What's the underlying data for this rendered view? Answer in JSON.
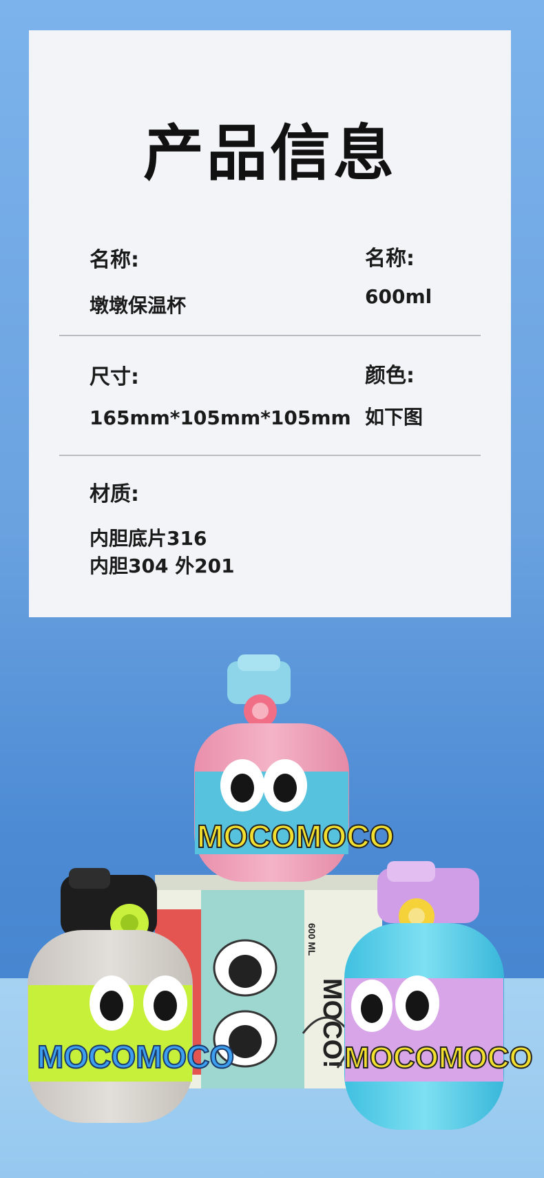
{
  "title": "产品信息",
  "info": {
    "name_label": "名称:",
    "name_value": "墩墩保温杯",
    "capacity_label": "名称:",
    "capacity_value": "600ml",
    "size_label": "尺寸:",
    "size_value": "165mm*105mm*105mm",
    "color_label": "颜色:",
    "color_value": "如下图",
    "material_label": "材质:",
    "material_line1": "内胆底片316",
    "material_line2": "内胆304  外201"
  },
  "product": {
    "brand_text": "MOCOMOCO",
    "box_text": "MOCO!",
    "box_capacity": "600 ML",
    "colors": {
      "pink_bottle": "#f1a9bf",
      "blue_band": "#5fc4e0",
      "lime_band": "#c6f03a",
      "gray_bottle": "#d8d4cf",
      "cyan_bottle": "#62d2ea",
      "lilac_band": "#d9a6e8"
    }
  }
}
